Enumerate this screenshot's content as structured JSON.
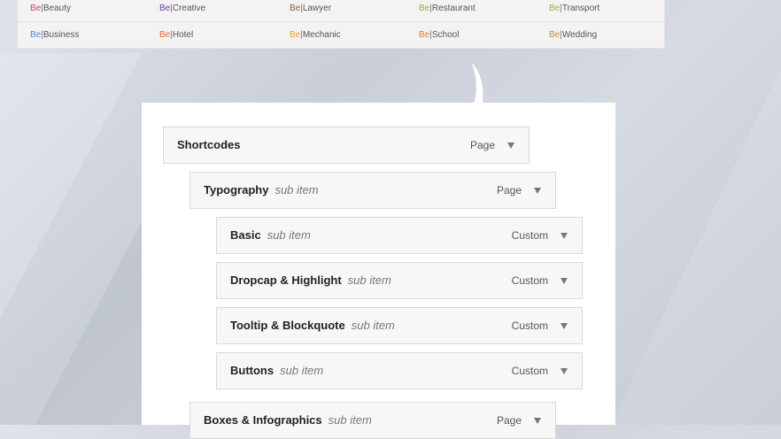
{
  "theme_links": [
    {
      "be": "Be",
      "sep": "|",
      "name": "Beauty",
      "color": "#d63a6b"
    },
    {
      "be": "Be",
      "sep": "|",
      "name": "Creative",
      "color": "#6a3fa8"
    },
    {
      "be": "Be",
      "sep": "|",
      "name": "Lawyer",
      "color": "#8b5a3c"
    },
    {
      "be": "Be",
      "sep": "|",
      "name": "Restaurant",
      "color": "#8ab63c"
    },
    {
      "be": "Be",
      "sep": "|",
      "name": "Transport",
      "color": "#8ab63c"
    },
    {
      "be": "Be",
      "sep": "|",
      "name": "Business",
      "color": "#3d8fd1"
    },
    {
      "be": "Be",
      "sep": "|",
      "name": "Hotel",
      "color": "#e0762f"
    },
    {
      "be": "Be",
      "sep": "|",
      "name": "Mechanic",
      "color": "#e0a42f"
    },
    {
      "be": "Be",
      "sep": "|",
      "name": "School",
      "color": "#e0762f"
    },
    {
      "be": "Be",
      "sep": "|",
      "name": "Wedding",
      "color": "#c98a4a"
    }
  ],
  "menu_items": [
    {
      "title": "Shortcodes",
      "sub": "",
      "type": "Page"
    },
    {
      "title": "Typography",
      "sub": "sub item",
      "type": "Page"
    },
    {
      "title": "Basic",
      "sub": "sub item",
      "type": "Custom"
    },
    {
      "title": "Dropcap & Highlight",
      "sub": "sub item",
      "type": "Custom"
    },
    {
      "title": "Tooltip & Blockquote",
      "sub": "sub item",
      "type": "Custom"
    },
    {
      "title": "Buttons",
      "sub": "sub item",
      "type": "Custom"
    },
    {
      "title": "Boxes & Infographics",
      "sub": "sub item",
      "type": "Page"
    }
  ],
  "icons": {
    "expand": "triangle-down-icon"
  }
}
